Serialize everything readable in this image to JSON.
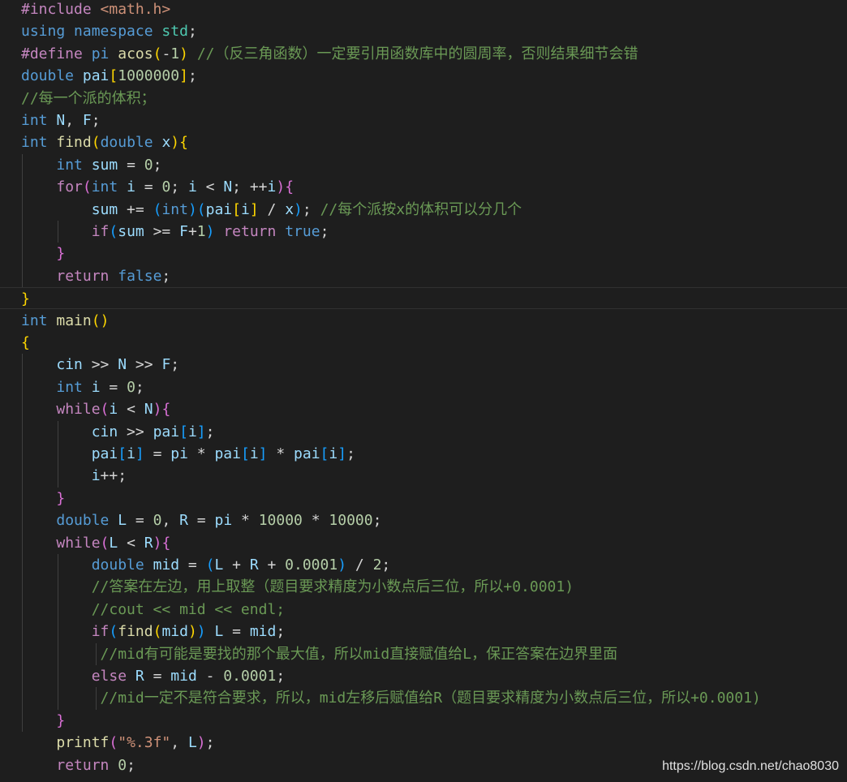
{
  "lines": [
    "#include <math.h>",
    "using namespace std;",
    "#define pi acos(-1) //（反三角函数）一定要引用函数库中的圆周率，否则结果细节会错",
    "double pai[1000000];",
    "//每一个派的体积；",
    "int N, F;",
    "int find(double x){",
    "    int sum = 0;",
    "    for(int i = 0; i < N; ++i){",
    "        sum += (int)(pai[i] / x); //每个派按x的体积可以分几个",
    "        if(sum >= F+1) return true;",
    "    }",
    "    return false;",
    "}",
    "int main()",
    "{",
    "    cin >> N >> F;",
    "    int i = 0;",
    "    while(i < N){",
    "        cin >> pai[i];",
    "        pai[i] = pi * pai[i] * pai[i];",
    "        i++;",
    "    }",
    "    double L = 0, R = pi * 10000 * 10000;",
    "    while(L < R){",
    "        double mid = (L + R + 0.0001) / 2;",
    "        //答案在左边，用上取整（题目要求精度为小数点后三位，所以+0.0001)",
    "        //cout << mid << endl;",
    "        if(find(mid)) L = mid;",
    "         //mid有可能是要找的那个最大值，所以mid直接赋值给L，保正答案在边界里面",
    "        else R = mid - 0.0001;",
    "         //mid一定不是符合要求，所以，mid左移后赋值给R（题目要求精度为小数点后三位，所以+0.0001)",
    "    }",
    "    printf(\"%.3f\", L);",
    "    return 0;"
  ],
  "watermark": "https://blog.csdn.net/chao8030",
  "colors": {
    "background": "#1e1e1e",
    "keyword": "#569cd6",
    "control": "#c586c0",
    "function": "#dcdcaa",
    "variable": "#9cdcfe",
    "number": "#b5cea8",
    "string": "#ce9178",
    "comment": "#6a9955",
    "bracket_level1": "#ffd700",
    "bracket_level2": "#da70d6",
    "bracket_level3": "#179fff"
  }
}
